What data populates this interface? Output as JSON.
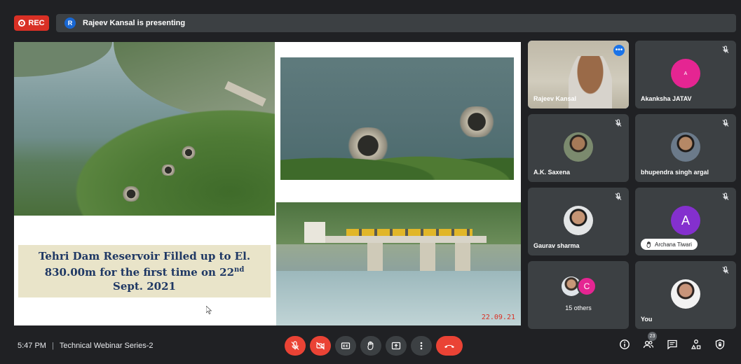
{
  "header": {
    "rec_label": "REC",
    "presenter_initial": "R",
    "presenting_text": "Rajeev Kansal is presenting"
  },
  "slide": {
    "caption_line1": "Tehri Dam Reservoir Filled up to El.",
    "caption_line2_pre": "830.00m for the first time on 22",
    "caption_line2_sup": "nd",
    "caption_line3": "Sept. 2021",
    "date_stamp": "22.09.21"
  },
  "participants": [
    {
      "name": "Rajeev Kansal",
      "type": "video",
      "active": true
    },
    {
      "name": "Akanksha JATAV",
      "initial": "A",
      "color": "#e52592",
      "muted": true
    },
    {
      "name": "A.K. Saxena",
      "muted": true
    },
    {
      "name": "bhupendra singh argal",
      "muted": true
    },
    {
      "name": "Gaurav sharma",
      "muted": true
    },
    {
      "name": "Archana Tiwari",
      "initial": "A",
      "color": "#8430ce",
      "muted": true,
      "hand_raised": true
    },
    {
      "name": "15 others",
      "others_initial": "C"
    },
    {
      "name": "You",
      "muted": true
    }
  ],
  "footer": {
    "time": "5:47 PM",
    "separator": "|",
    "meeting_title": "Technical Webinar Series-2",
    "participant_count": "23"
  },
  "colors": {
    "background": "#202124",
    "tile": "#3c4043",
    "danger": "#ea4335",
    "accent": "#1a73e8"
  }
}
